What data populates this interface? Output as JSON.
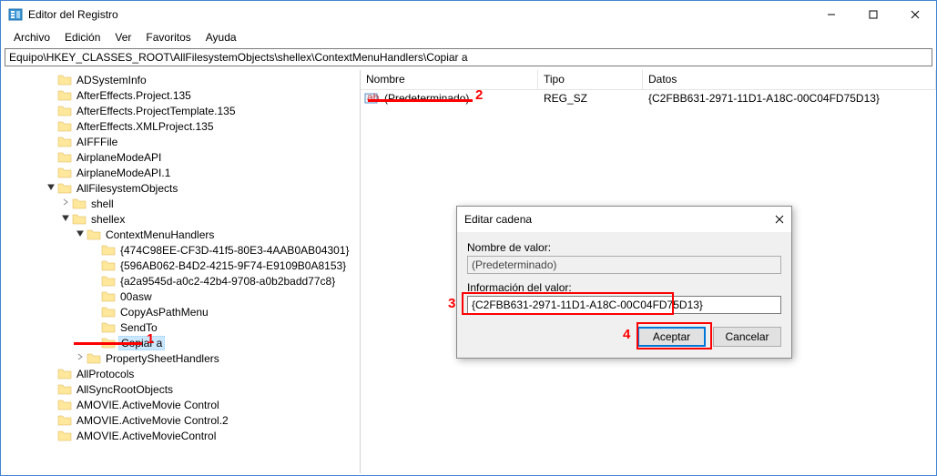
{
  "window": {
    "title": "Editor del Registro",
    "min": "—",
    "max": "☐",
    "close": "✕"
  },
  "menu": {
    "archivo": "Archivo",
    "edicion": "Edición",
    "ver": "Ver",
    "favoritos": "Favoritos",
    "ayuda": "Ayuda"
  },
  "address": "Equipo\\HKEY_CLASSES_ROOT\\AllFilesystemObjects\\shellex\\ContextMenuHandlers\\Copiar a",
  "tree": [
    {
      "indent": 3,
      "exp": "",
      "label": "ADSystemInfo"
    },
    {
      "indent": 3,
      "exp": "",
      "label": "AfterEffects.Project.135"
    },
    {
      "indent": 3,
      "exp": "",
      "label": "AfterEffects.ProjectTemplate.135"
    },
    {
      "indent": 3,
      "exp": "",
      "label": "AfterEffects.XMLProject.135"
    },
    {
      "indent": 3,
      "exp": "",
      "label": "AIFFFile"
    },
    {
      "indent": 3,
      "exp": "",
      "label": "AirplaneModeAPI"
    },
    {
      "indent": 3,
      "exp": "",
      "label": "AirplaneModeAPI.1"
    },
    {
      "indent": 3,
      "exp": "open",
      "label": "AllFilesystemObjects"
    },
    {
      "indent": 4,
      "exp": ">",
      "label": "shell"
    },
    {
      "indent": 4,
      "exp": "open",
      "label": "shellex"
    },
    {
      "indent": 5,
      "exp": "open",
      "label": "ContextMenuHandlers"
    },
    {
      "indent": 6,
      "exp": "",
      "label": "{474C98EE-CF3D-41f5-80E3-4AAB0AB04301}"
    },
    {
      "indent": 6,
      "exp": "",
      "label": "{596AB062-B4D2-4215-9F74-E9109B0A8153}"
    },
    {
      "indent": 6,
      "exp": "",
      "label": "{a2a9545d-a0c2-42b4-9708-a0b2badd77c8}"
    },
    {
      "indent": 6,
      "exp": "",
      "label": "00asw"
    },
    {
      "indent": 6,
      "exp": "",
      "label": "CopyAsPathMenu"
    },
    {
      "indent": 6,
      "exp": "",
      "label": "SendTo"
    },
    {
      "indent": 6,
      "exp": "",
      "label": "Copiar a",
      "selected": true
    },
    {
      "indent": 5,
      "exp": ">",
      "label": "PropertySheetHandlers"
    },
    {
      "indent": 3,
      "exp": "",
      "label": "AllProtocols"
    },
    {
      "indent": 3,
      "exp": "",
      "label": "AllSyncRootObjects"
    },
    {
      "indent": 3,
      "exp": "",
      "label": "AMOVIE.ActiveMovie Control"
    },
    {
      "indent": 3,
      "exp": "",
      "label": "AMOVIE.ActiveMovie Control.2"
    },
    {
      "indent": 3,
      "exp": "",
      "label": "AMOVIE.ActiveMovieControl"
    }
  ],
  "list": {
    "headers": {
      "name": "Nombre",
      "type": "Tipo",
      "data": "Datos"
    },
    "rows": [
      {
        "name": "(Predeterminado)",
        "type": "REG_SZ",
        "data": "{C2FBB631-2971-11D1-A18C-00C04FD75D13}"
      }
    ]
  },
  "dialog": {
    "title": "Editar cadena",
    "name_label": "Nombre de valor:",
    "name_value": "(Predeterminado)",
    "data_label": "Información del valor:",
    "data_value": "{C2FBB631-2971-11D1-A18C-00C04FD75D13}",
    "ok": "Aceptar",
    "cancel": "Cancelar"
  },
  "annotations": {
    "a1": "1",
    "a2": "2",
    "a3": "3",
    "a4": "4"
  }
}
